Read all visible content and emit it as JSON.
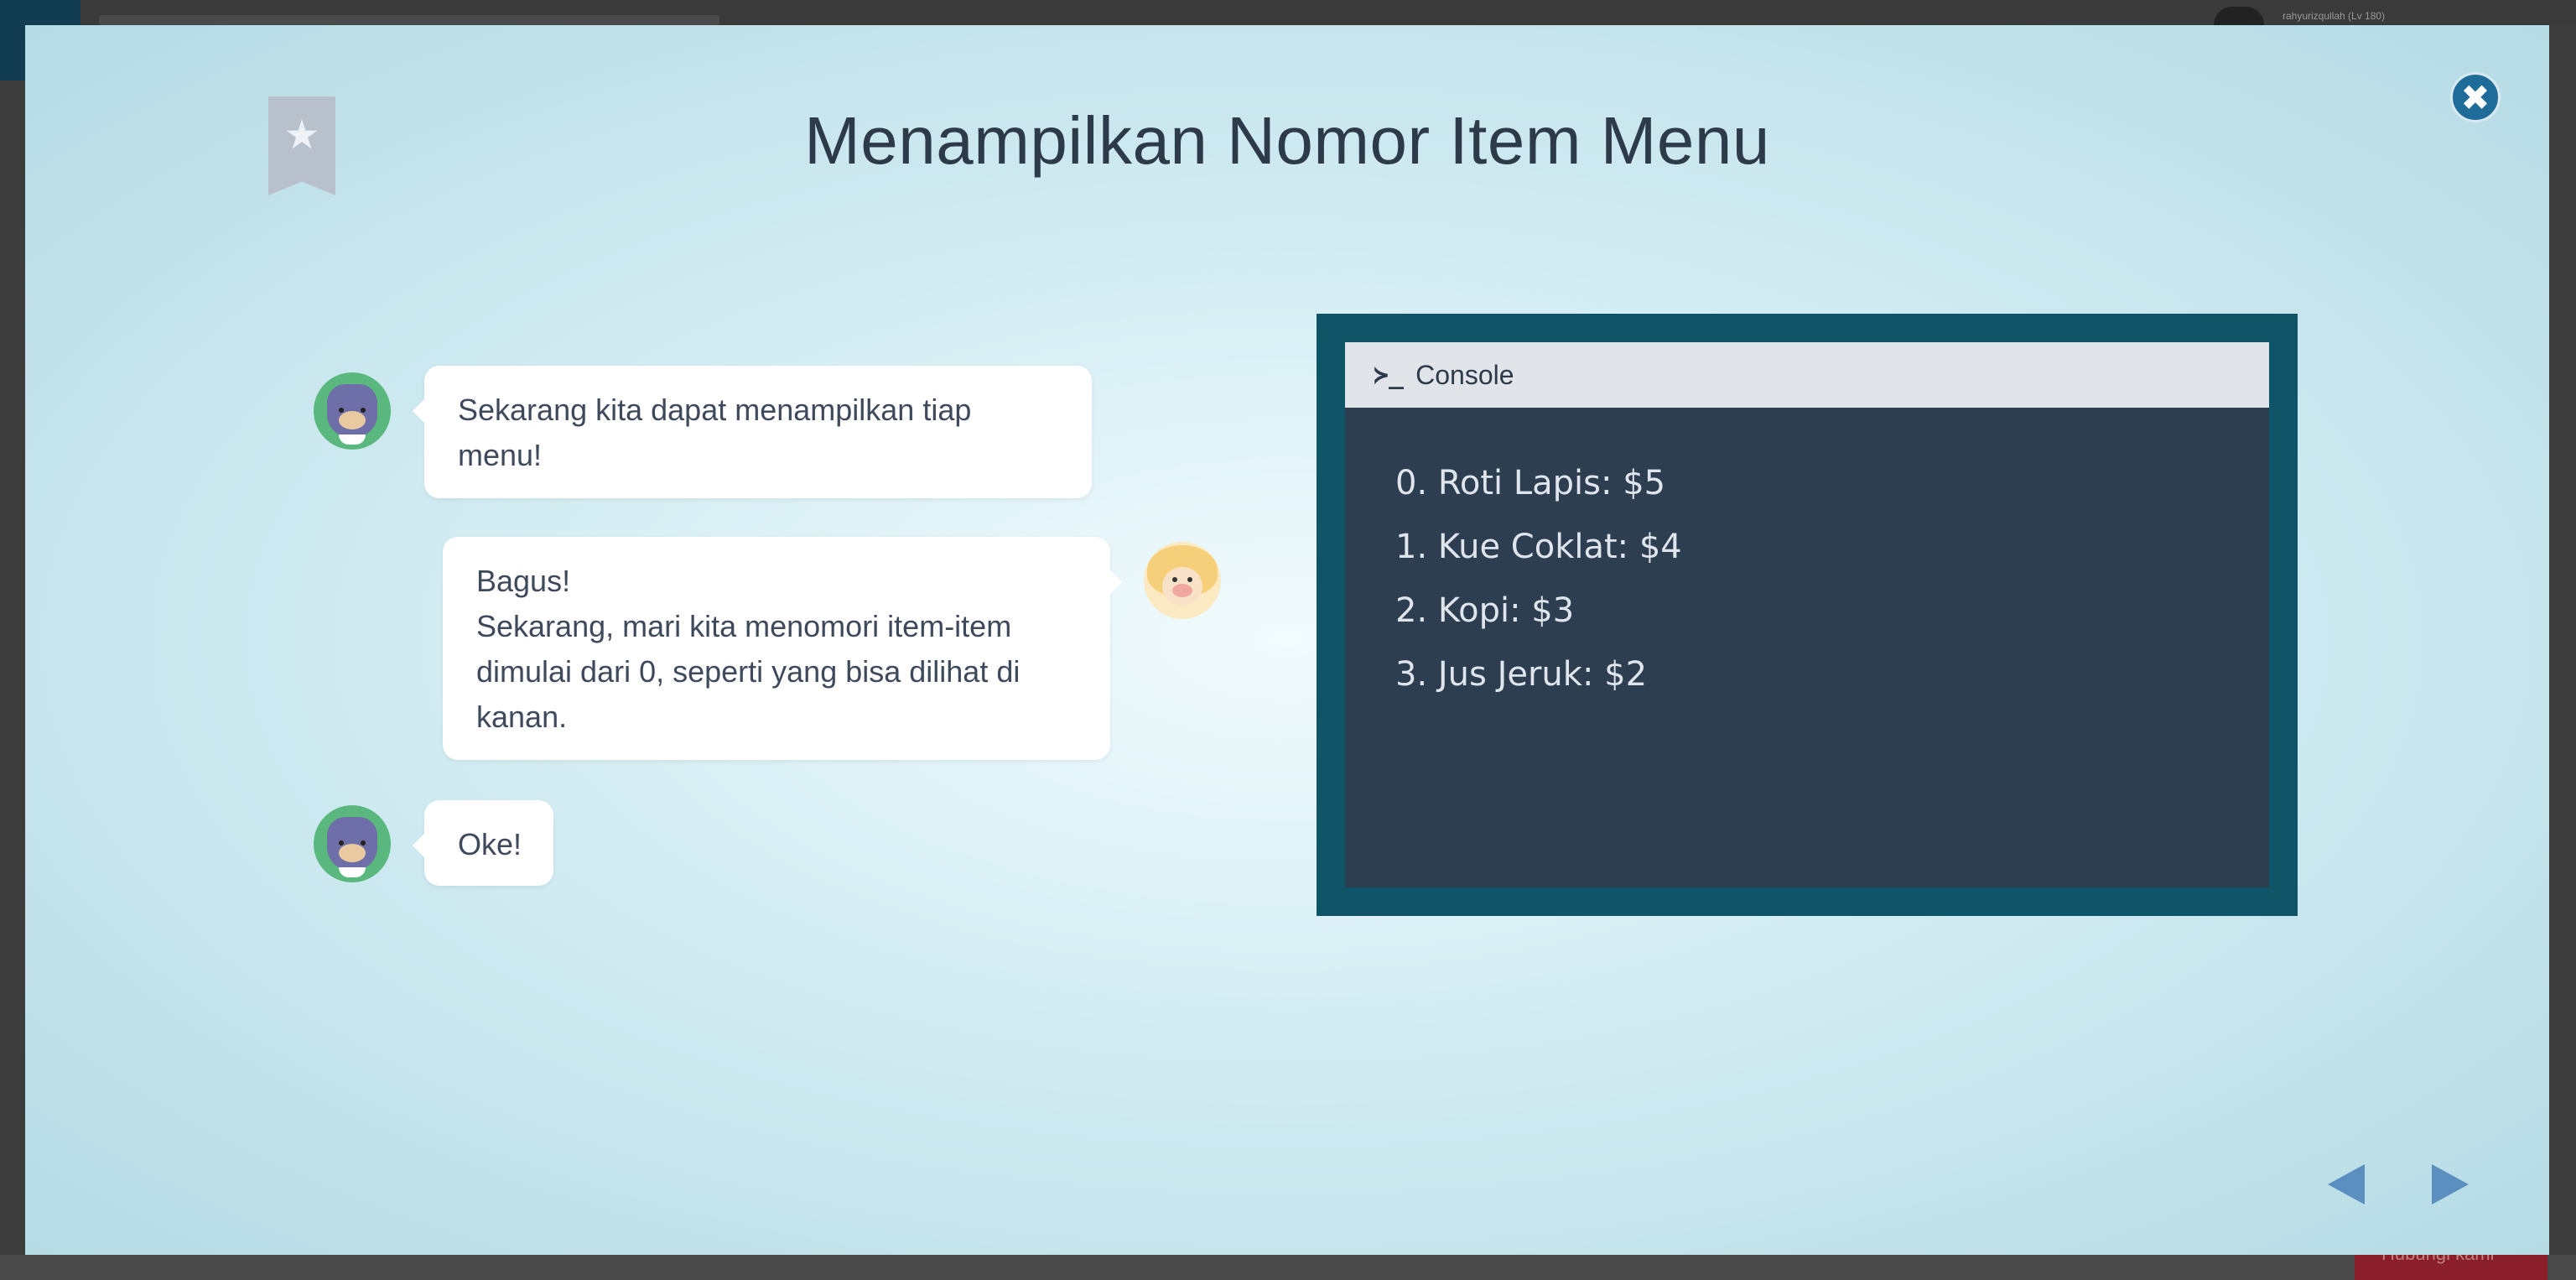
{
  "background": {
    "user_label": "rahyurizqullah (Lv 180)",
    "bottom_button_label": "Hubungi kami"
  },
  "modal": {
    "title": "Menampilkan Nomor Item Menu",
    "bookmark_icon": "star-icon",
    "close_icon": "close-icon",
    "close_glyph": "✖",
    "colors": {
      "accent": "#1f6c9a",
      "console_frame": "#0f5567",
      "console_body": "#2c3e50",
      "nav_arrow": "#5b8fc0"
    }
  },
  "chat": {
    "messages": [
      {
        "speaker": "cat",
        "side": "left",
        "lines": [
          "Sekarang kita dapat menampilkan tiap",
          "menu!"
        ]
      },
      {
        "speaker": "sheep",
        "side": "right",
        "lines": [
          "Bagus!",
          "Sekarang, mari kita menomori item-item",
          "dimulai dari 0, seperti yang bisa dilihat di",
          "kanan."
        ]
      },
      {
        "speaker": "cat",
        "side": "left",
        "lines": [
          "Oke!"
        ]
      }
    ]
  },
  "console": {
    "header_icon": "terminal-icon",
    "header_glyph": "≻_",
    "header_label": "Console",
    "output": [
      "0. Roti Lapis: $5",
      "1. Kue Coklat: $4",
      "2. Kopi: $3",
      "3. Jus Jeruk: $2"
    ]
  },
  "navigation": {
    "prev_icon": "triangle-left-icon",
    "next_icon": "triangle-right-icon"
  }
}
